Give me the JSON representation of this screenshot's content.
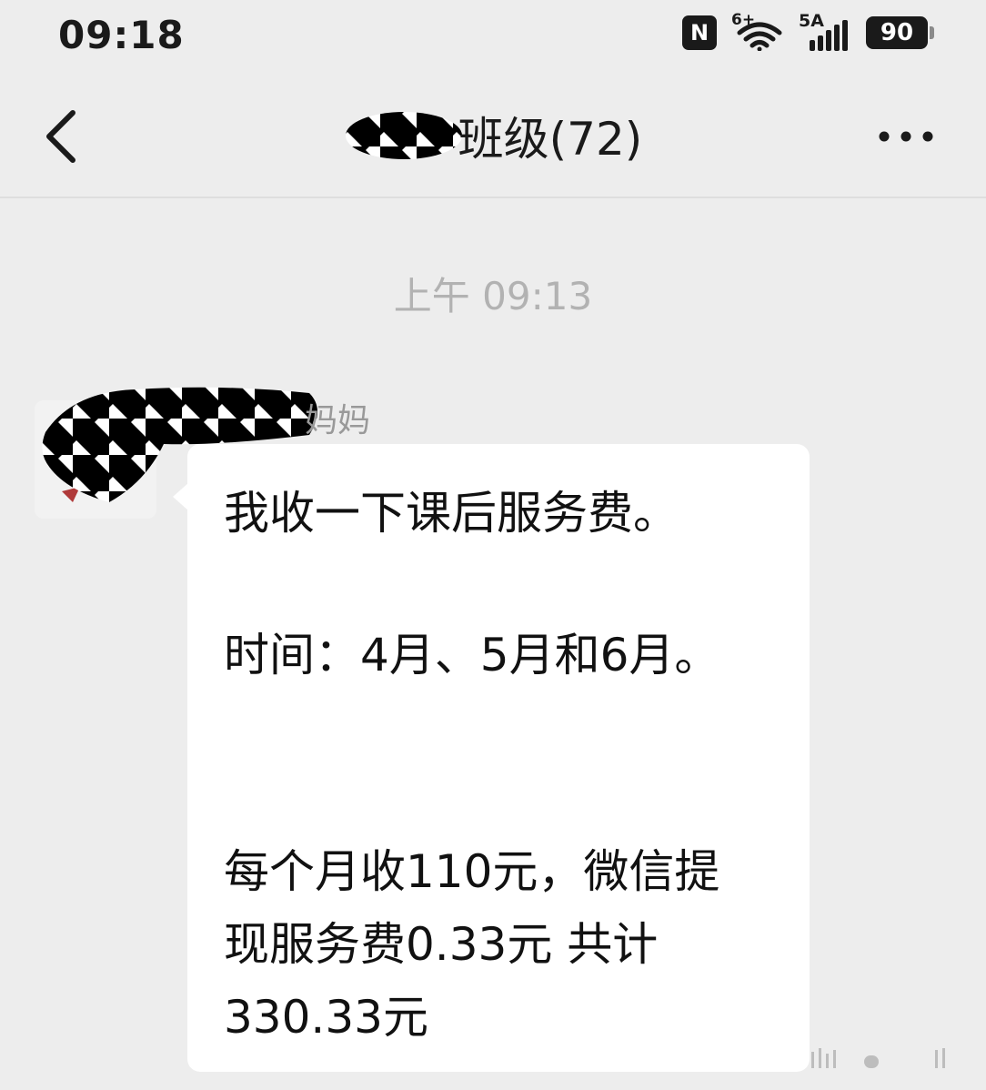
{
  "status_bar": {
    "time": "09:18",
    "nfc_label": "N",
    "wifi_label": "6+",
    "signal_label": "5A",
    "battery_level": "90",
    "icons": [
      "nfc-icon",
      "wifi-icon",
      "signal-icon",
      "battery-icon"
    ]
  },
  "nav": {
    "title": "班级(72)",
    "back_icon": "chevron-left-icon",
    "more_icon": "more-dots-icon"
  },
  "chat": {
    "timestamp": "上午 09:13",
    "sender_name": "妈妈",
    "message_lines": [
      "我收一下课后服务费。",
      "时间：4月、5月和6月。",
      "每个月收110元，微信提",
      "现服务费0.33元  共计",
      "330.33元"
    ]
  },
  "colors": {
    "background": "#ededed",
    "bubble": "#ffffff",
    "timestamp": "#b2b2b2",
    "sender_name": "#999999"
  }
}
